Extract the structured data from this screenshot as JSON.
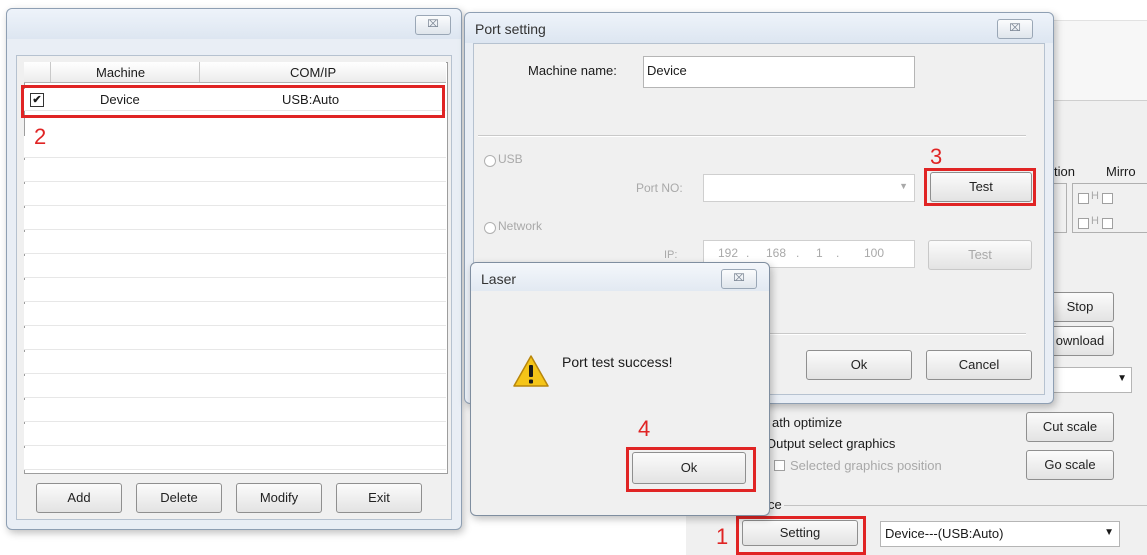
{
  "machine_window": {
    "close_glyph": "⌧",
    "columns": [
      "Machine",
      "COM/IP"
    ],
    "rows": [
      {
        "checked": "✔",
        "machine": "Device",
        "com_ip": "USB:Auto"
      }
    ],
    "buttons": [
      "Add",
      "Delete",
      "Modify",
      "Exit"
    ]
  },
  "port_window": {
    "title": "Port setting",
    "close_glyph": "⌧",
    "machine_name_label": "Machine name:",
    "machine_name_value": "Device",
    "usb_label": "USB",
    "port_no_label": "Port NO:",
    "test_label": "Test",
    "network_label": "Network",
    "ip_label": "IP:",
    "ip": [
      "192",
      "168",
      "1",
      "100"
    ],
    "ip_dot": ".",
    "test2_label": "Test",
    "ok_label": "Ok",
    "cancel_label": "Cancel"
  },
  "laser_dialog": {
    "title": "Laser",
    "close_glyph": "⌧",
    "message": "Port test success!",
    "ok_label": "Ok",
    "warning_mark": "!"
  },
  "background_window": {
    "col_tion": "tion",
    "col_mirror": "Mirro",
    "h1": "H",
    "h2": "H",
    "stop_label": "Stop",
    "download_label": "ownload",
    "path_optimize": "ath optimize",
    "output_select": "Output select graphics",
    "selected_pos": "Selected graphics position",
    "cut_scale": "Cut scale",
    "go_scale": "Go scale",
    "section_label": "ce",
    "setting_label": "Setting",
    "device_select": "Device---(USB:Auto)",
    "dropdown_arrow": "▼"
  },
  "steps": [
    "1",
    "2",
    "3",
    "4"
  ]
}
